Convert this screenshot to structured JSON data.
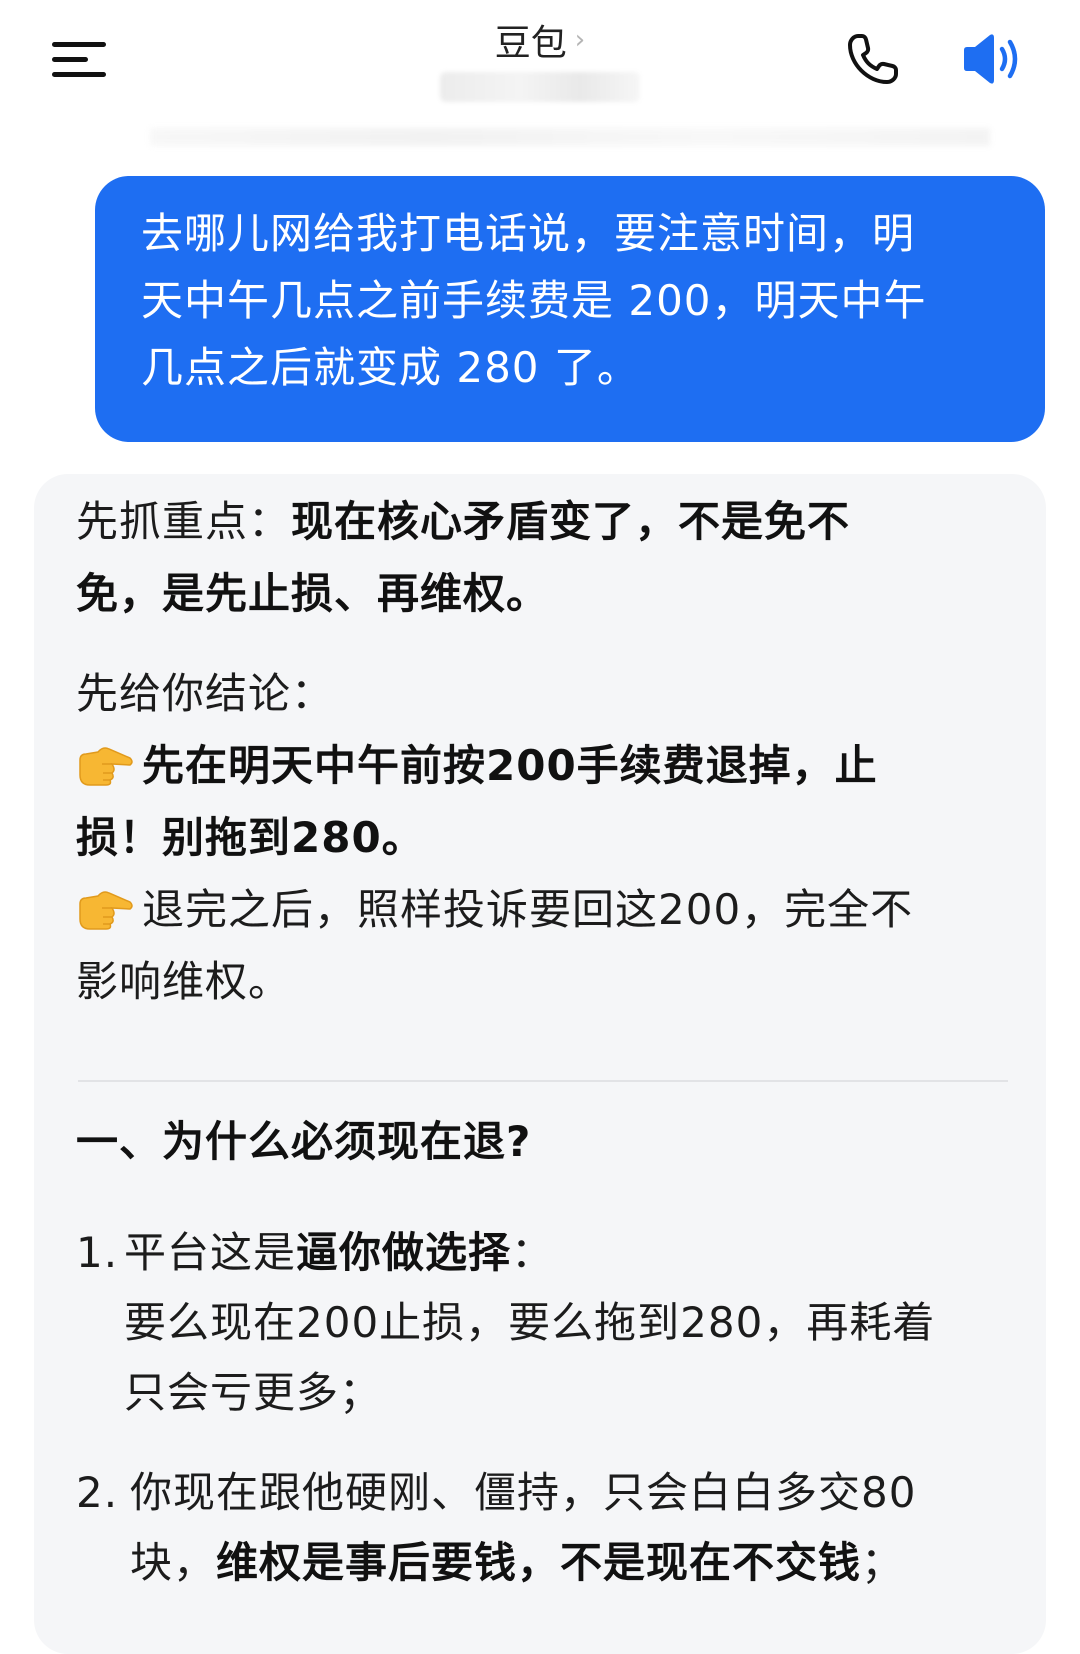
{
  "header": {
    "title": "豆包",
    "title_chevron": "›",
    "icons": {
      "menu": "hamburger-menu-icon",
      "phone": "phone-icon",
      "speaker": "speaker-icon"
    },
    "accent_color": "#1e6ef2"
  },
  "user_message": {
    "lines": [
      "去哪儿网给我打电话说，要注意时间，明",
      "天中午几点之前手续费是 200，明天中午",
      "几点之后就变成 280 了。"
    ]
  },
  "bot_message": {
    "key_point": {
      "label": "先抓重点：",
      "bold_1": "现在核心矛盾变了，不是免不",
      "bold_2": "免，是先止损、再维权。"
    },
    "conclusion": {
      "label": "先给你结论：",
      "item1_line1": "先在明天中午前按200手续费退掉，止",
      "item1_line2": "损！别拖到280。",
      "item2_line1": "退完之后，照样投诉要回这200，完全不",
      "item2_line2": "影响维权。",
      "bullet_icon": "pointing-hand-icon"
    },
    "section1": {
      "heading": "一、为什么必须现在退?",
      "items": [
        {
          "num": "1.",
          "line1_pre": "平台这是",
          "line1_bold": "逼你做选择",
          "line1_post": "：",
          "line2": "要么现在200止损，要么拖到280，再耗着",
          "line3": "只会亏更多；"
        },
        {
          "num": "2.",
          "line1": "你现在跟他硬刚、僵持，只会白白多交80",
          "line2_pre": "块，",
          "line2_bold": "维权是事后要钱，不是现在不交钱",
          "line2_post": "；"
        }
      ]
    }
  }
}
